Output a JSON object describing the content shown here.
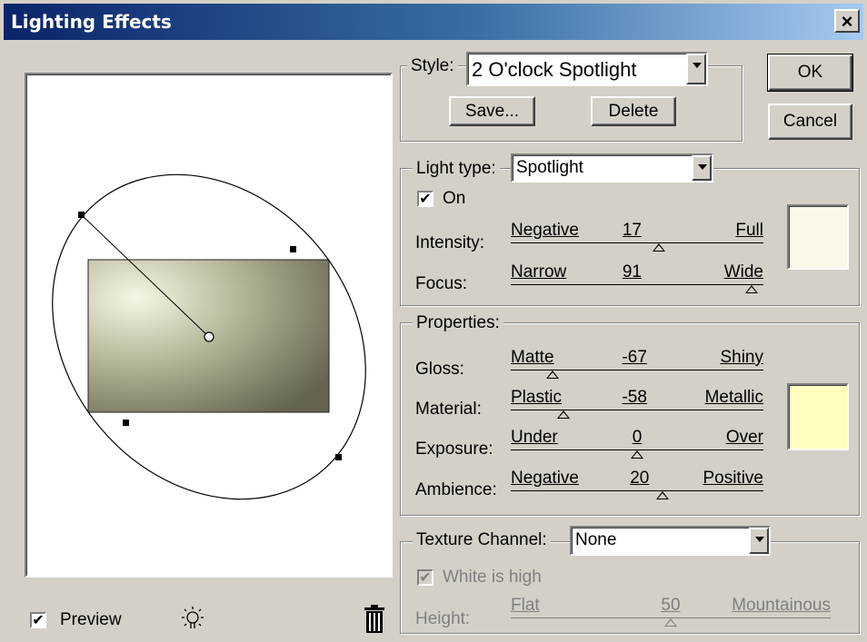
{
  "window": {
    "title": "Lighting Effects",
    "close_label": "×"
  },
  "buttons": {
    "ok": "OK",
    "cancel": "Cancel",
    "save": "Save...",
    "delete": "Delete"
  },
  "style": {
    "label": "Style:",
    "value": "2 O'clock Spotlight"
  },
  "light_type": {
    "label": "Light type:",
    "value": "Spotlight",
    "on_label": "On",
    "on_checked": true,
    "color": "#fbf8ea",
    "intensity": {
      "label": "Intensity:",
      "left": "Negative",
      "value": "17",
      "right": "Full",
      "level": 0.585
    },
    "focus": {
      "label": "Focus:",
      "left": "Narrow",
      "value": "91",
      "right": "Wide",
      "level": 0.955
    }
  },
  "properties": {
    "title": "Properties:",
    "color": "#fffdc0",
    "gloss": {
      "label": "Gloss:",
      "left": "Matte",
      "value": "-67",
      "right": "Shiny",
      "level": 0.165
    },
    "material": {
      "label": "Material:",
      "left": "Plastic",
      "value": "-58",
      "right": "Metallic",
      "level": 0.21
    },
    "exposure": {
      "label": "Exposure:",
      "left": "Under",
      "value": "0",
      "right": "Over",
      "level": 0.5
    },
    "ambience": {
      "label": "Ambience:",
      "left": "Negative",
      "value": "20",
      "right": "Positive",
      "level": 0.6
    }
  },
  "texture": {
    "label": "Texture Channel:",
    "value": "None",
    "white_is_high_label": "White is high",
    "white_is_high_checked": true,
    "height": {
      "label": "Height:",
      "left": "Flat",
      "value": "50",
      "right": "Mountainous",
      "level": 0.5
    }
  },
  "preview": {
    "label": "Preview",
    "checked": true
  },
  "icons": {
    "new_light": "lightbulb-icon",
    "delete_light": "trash-icon"
  }
}
